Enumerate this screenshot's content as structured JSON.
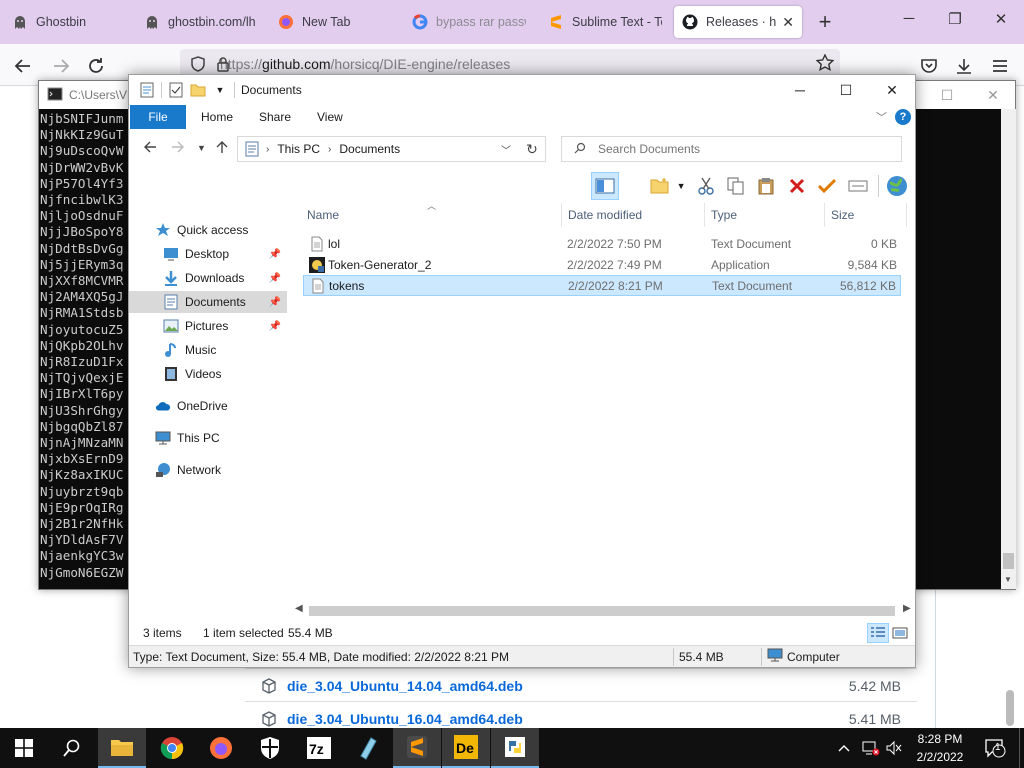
{
  "browser": {
    "tabs": [
      {
        "label": "Ghostbin",
        "icon": "ghost-icon"
      },
      {
        "label": "ghostbin.com/lh",
        "icon": "ghost-icon"
      },
      {
        "label": "New Tab",
        "icon": "firefox-icon"
      },
      {
        "label": "bypass rar passw",
        "icon": "google-icon"
      },
      {
        "label": "Sublime Text - Te",
        "icon": "sublime-icon"
      },
      {
        "label": "Releases · hors",
        "icon": "github-icon"
      }
    ],
    "url_prefix": "https://",
    "url_host": "github.com",
    "url_path": "/horsicq/DIE-engine/releases",
    "accent": "#e3cdee"
  },
  "cmd": {
    "title": "C:\\Users\\VM",
    "lines": [
      "NjbSNIFJunm",
      "NjNkKIz9GuT",
      "Nj9uDscoQvW",
      "NjDrWW2vBvK",
      "NjP57Ol4Yf3",
      "NjfncibwlK3",
      "NjljoOsdnuF",
      "NjjJBoSpoY8",
      "NjDdtBsDvGg",
      "Nj5jjERym3q",
      "NjXXf8MCVMR",
      "Nj2AM4XQ5gJ",
      "NjRMA1Stdsb",
      "NjoyutocuZ5",
      "NjQKpb2OLhv",
      "NjR8IzuD1Fx",
      "NjTQjvQexjE",
      "NjIBrXlT6py",
      "NjU3ShrGhgy",
      "NjbgqQbZl87",
      "NjnAjMNzaMN",
      "NjxbXsErnD9",
      "NjKz8axIKUC",
      "Njuybrzt9qb",
      "NjE9prOqIRg",
      "Nj2B1r2NfHk",
      "NjYDldAsF7V",
      "NjaenkgYC3w",
      "NjGmoN6EGZW"
    ]
  },
  "explorer": {
    "title": "Documents",
    "ribbon_tabs": [
      "File",
      "Home",
      "Share",
      "View"
    ],
    "breadcrumb": [
      "This PC",
      "Documents"
    ],
    "search_placeholder": "Search Documents",
    "nav": [
      {
        "label": "Quick access",
        "icon": "star-icon"
      },
      {
        "label": "Desktop",
        "icon": "desktop-icon",
        "pinned": true
      },
      {
        "label": "Downloads",
        "icon": "download-icon",
        "pinned": true
      },
      {
        "label": "Documents",
        "icon": "documents-icon",
        "pinned": true,
        "selected": true
      },
      {
        "label": "Pictures",
        "icon": "pictures-icon",
        "pinned": true
      },
      {
        "label": "Music",
        "icon": "music-icon"
      },
      {
        "label": "Videos",
        "icon": "videos-icon"
      },
      {
        "label": "OneDrive",
        "icon": "cloud-icon"
      },
      {
        "label": "This PC",
        "icon": "computer-icon"
      },
      {
        "label": "Network",
        "icon": "network-icon"
      }
    ],
    "columns": [
      "Name",
      "Date modified",
      "Type",
      "Size"
    ],
    "files": [
      {
        "name": "lol",
        "date": "2/2/2022 7:50 PM",
        "type": "Text Document",
        "size": "0 KB",
        "icon": "text-file-icon"
      },
      {
        "name": "Token-Generator_2",
        "date": "2/2/2022 7:49 PM",
        "type": "Application",
        "size": "9,584 KB",
        "icon": "app-icon"
      },
      {
        "name": "tokens",
        "date": "2/2/2022 8:21 PM",
        "type": "Text Document",
        "size": "56,812 KB",
        "icon": "text-file-icon",
        "selected": true
      }
    ],
    "status_count": "3 items",
    "status_selected": "1 item selected",
    "status_size": "55.4 MB",
    "details_text": "Type: Text Document, Size: 55.4 MB, Date modified: 2/2/2022 8:21 PM",
    "details_size": "55.4 MB",
    "details_location": "Computer"
  },
  "github": {
    "assets": [
      {
        "name": "die_3.04_Ubuntu_14.04_amd64.deb",
        "size": "5.42 MB"
      },
      {
        "name": "die_3.04_Ubuntu_16.04_amd64.deb",
        "size": "5.41 MB"
      }
    ],
    "link_color": "#0969da"
  },
  "taskbar": {
    "time": "8:28 PM",
    "date": "2/2/2022",
    "notifications": "1"
  }
}
